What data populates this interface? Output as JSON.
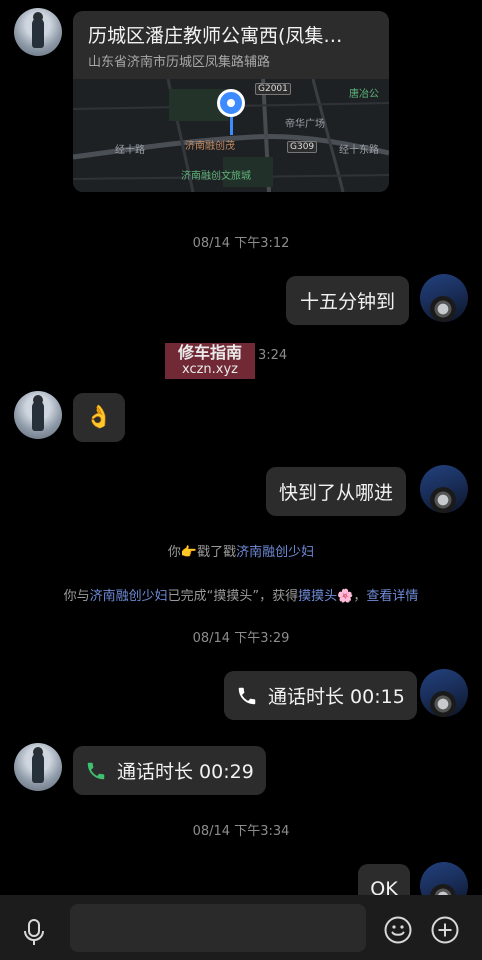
{
  "location_card": {
    "title": "历城区潘庄教师公寓西(凤集…",
    "address": "山东省济南市历城区凤集路辅路",
    "map_labels": {
      "road_west": "经十路",
      "road_east": "经十东路",
      "poi_1": "济南融创茂",
      "poi_2": "济南融创文旅城",
      "poi_3": "帝华广场",
      "poi_4": "唐冶公",
      "hwy_1": "G2001",
      "hwy_2": "G309"
    }
  },
  "timestamps": {
    "t1": "08/14 下午3:12",
    "t2_partial": "3:24",
    "t3": "08/14 下午3:29",
    "t4": "08/14 下午3:34"
  },
  "messages": {
    "m1": "十五分钟到",
    "m2_emoji": "👌",
    "m3": "快到了从哪进",
    "call_out": "通话时长 00:15",
    "call_in": "通话时长 00:29",
    "m4": "OK"
  },
  "system": {
    "poke_you": "你",
    "poke_icon": "👉",
    "poke_action": "戳了戳",
    "poke_name": "济南融创少妇",
    "pat_prefix": "你与",
    "pat_name": "济南融创少妇",
    "pat_mid": "已完成“摸摸头”，获得",
    "pat_reward": "摸摸头",
    "pat_emoji": "🌸",
    "pat_sep": "，",
    "pat_link": "查看详情"
  },
  "watermark": {
    "line1": "修车指南",
    "line2": "xczn.xyz"
  },
  "icons": [
    "mic-icon",
    "emoji-icon",
    "plus-icon",
    "phone-icon",
    "location-pin-icon"
  ],
  "colors": {
    "background": "#000000",
    "bubble": "#2c2c2c",
    "link": "#6f8bd8",
    "timestamp": "#8c8c8c",
    "call_icon_out": "#ffffff",
    "call_icon_in": "#3fbf6f"
  }
}
